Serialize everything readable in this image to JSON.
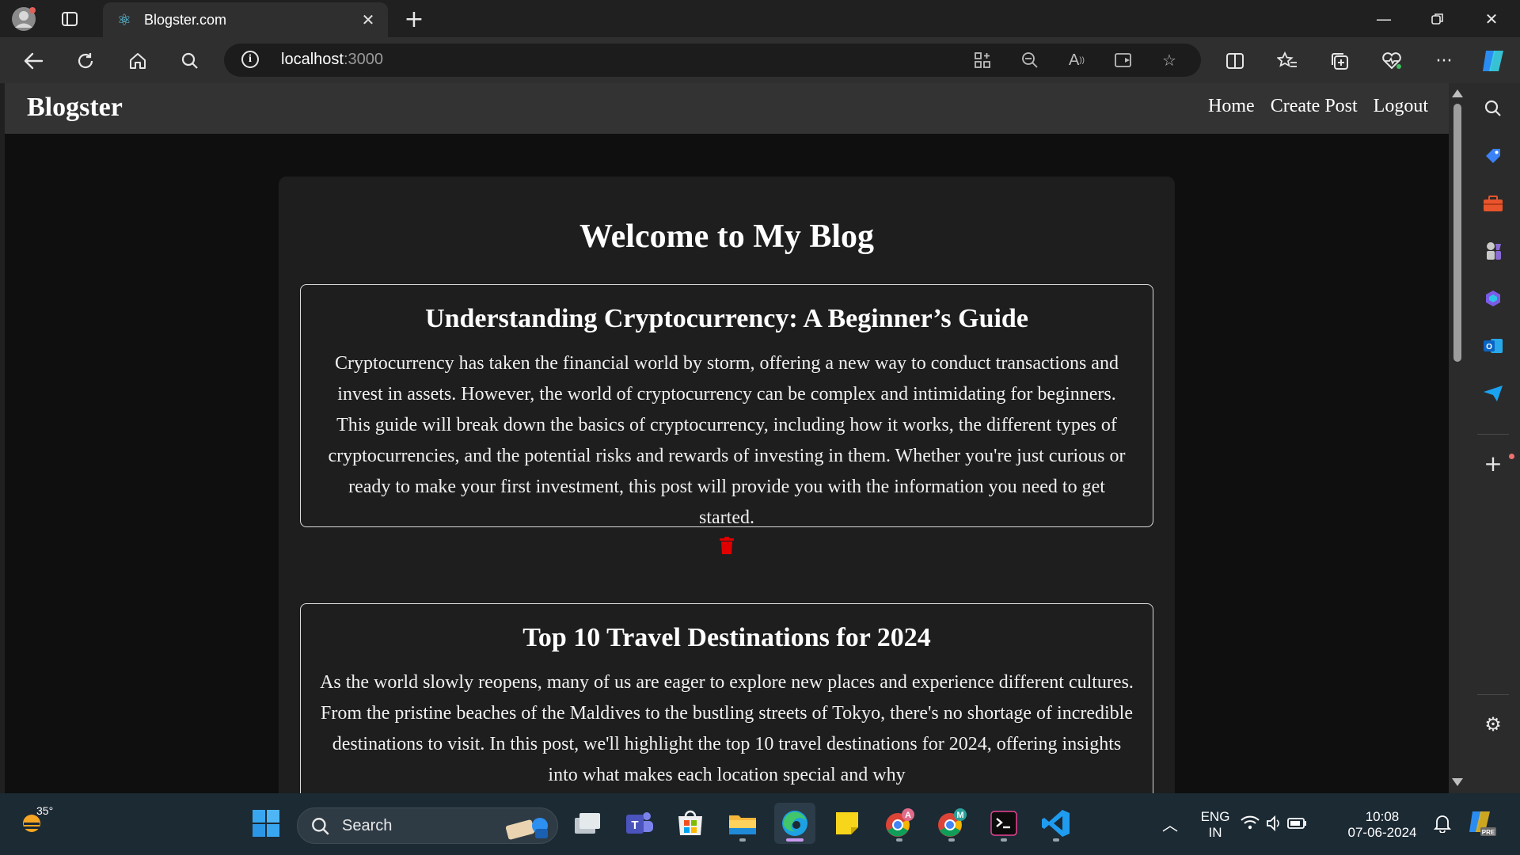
{
  "browser": {
    "tab_title": "Blogster.com",
    "url_host": "localhost",
    "url_port": ":3000"
  },
  "site": {
    "brand": "Blogster",
    "nav": [
      "Home",
      "Create Post",
      "Logout"
    ],
    "page_title": "Welcome to My Blog",
    "posts": [
      {
        "title": "Understanding Cryptocurrency: A Beginner’s Guide",
        "body": "Cryptocurrency has taken the financial world by storm, offering a new way to conduct transactions and invest in assets. However, the world of cryptocurrency can be complex and intimidating for beginners. This guide will break down the basics of cryptocurrency, including how it works, the different types of cryptocurrencies, and the potential risks and rewards of investing in them. Whether you're just curious or ready to make your first investment, this post will provide you with the information you need to get started."
      },
      {
        "title": "Top 10 Travel Destinations for 2024",
        "body": "As the world slowly reopens, many of us are eager to explore new places and experience different cultures. From the pristine beaches of the Maldives to the bustling streets of Tokyo, there's no shortage of incredible destinations to visit. In this post, we'll highlight the top 10 travel destinations for 2024, offering insights into what makes each location special and why"
      }
    ]
  },
  "taskbar": {
    "weather_temp": "35°",
    "search_label": "Search",
    "lang_top": "ENG",
    "lang_bottom": "IN",
    "time": "10:08",
    "date": "07-06-2024"
  },
  "colors": {
    "trash_icon": "#e00000",
    "page_bg": "#0f0f0f",
    "card_bg": "#1e1e1e",
    "navbar_bg": "#333333"
  }
}
